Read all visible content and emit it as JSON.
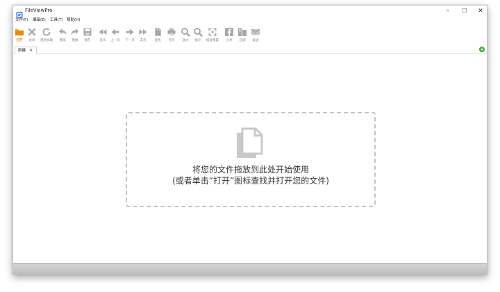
{
  "app": {
    "title": "FileViewPro"
  },
  "window_controls": {
    "minimize": "–",
    "maximize": "☐",
    "close": "✕"
  },
  "menu": [
    {
      "label": "文件(F)"
    },
    {
      "label": "编辑(E)"
    },
    {
      "label": "工具(T)"
    },
    {
      "label": "帮助(H)"
    }
  ],
  "toolbar": [
    {
      "label": "打开",
      "icon": "open-folder-icon",
      "active": true
    },
    {
      "label": "关闭",
      "icon": "close-icon"
    },
    {
      "label": "重新加载",
      "icon": "reload-icon"
    },
    {
      "label": "撤销",
      "icon": "undo-icon"
    },
    {
      "label": "重做",
      "icon": "redo-icon"
    },
    {
      "label": "保存",
      "icon": "save-icon"
    },
    {
      "label": "首页",
      "icon": "first-page-icon"
    },
    {
      "label": "上一页",
      "icon": "previous-page-icon"
    },
    {
      "label": "下一页",
      "icon": "next-page-icon"
    },
    {
      "label": "末页",
      "icon": "last-page-icon"
    },
    {
      "label": "查找",
      "icon": "find-icon"
    },
    {
      "label": "打印",
      "icon": "print-icon"
    },
    {
      "label": "放大",
      "icon": "zoom-in-icon"
    },
    {
      "label": "缩小",
      "icon": "zoom-out-icon"
    },
    {
      "label": "缩放重置",
      "icon": "zoom-reset-icon"
    },
    {
      "label": "分享",
      "icon": "facebook-icon"
    },
    {
      "label": "压缩",
      "icon": "compress-icon"
    },
    {
      "label": "发送",
      "icon": "email-icon"
    }
  ],
  "tabs": [
    {
      "label": "新建",
      "close": "✕"
    }
  ],
  "add_tab": "+",
  "dropzone": {
    "line1": "将您的文件拖放到此处开始使用",
    "line2": "(或者单击“打开”图标查找并打开您的文件)"
  },
  "colors": {
    "accent": "#e07b14",
    "icon_gray": "#a9a9a9",
    "add_green": "#3aa53a"
  }
}
